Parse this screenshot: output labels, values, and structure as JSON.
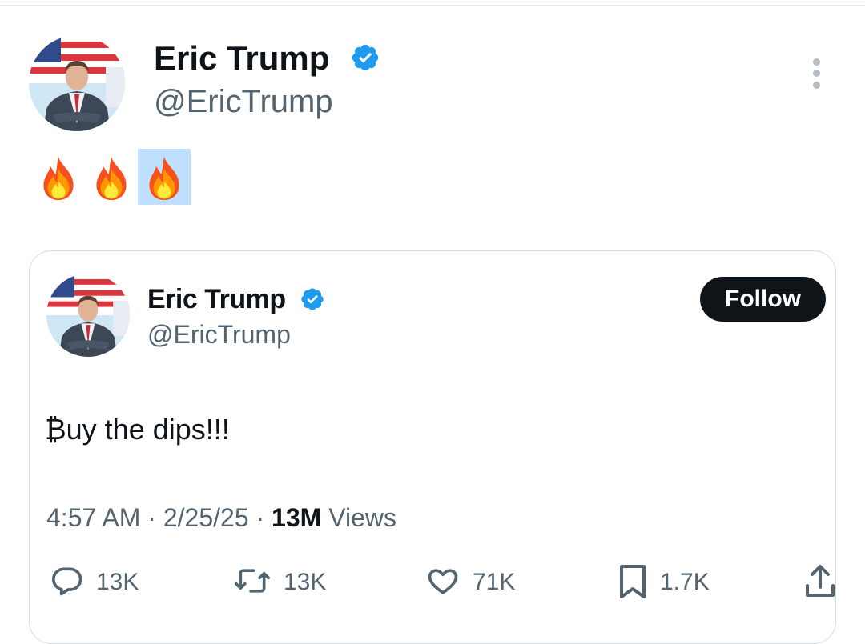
{
  "tweet": {
    "author_name": "Eric Trump",
    "author_handle": "@EricTrump",
    "emoji": [
      "🔥",
      "🔥",
      "🔥"
    ]
  },
  "quoted_tweet": {
    "author_name": "Eric Trump",
    "author_handle": "@EricTrump",
    "follow_label": "Follow",
    "text": "₿uy the dips!!!",
    "time": "4:57 AM",
    "date": "2/25/25",
    "views_count": "13M",
    "views_label": "Views",
    "separator": "·"
  },
  "actions": {
    "replies": "13K",
    "reposts": "13K",
    "likes": "71K",
    "bookmarks": "1.7K"
  },
  "colors": {
    "verified": "#1d9bf0",
    "secondary_text": "#536471",
    "follow_bg": "#0f1419",
    "selection": "#bfe1ff"
  }
}
